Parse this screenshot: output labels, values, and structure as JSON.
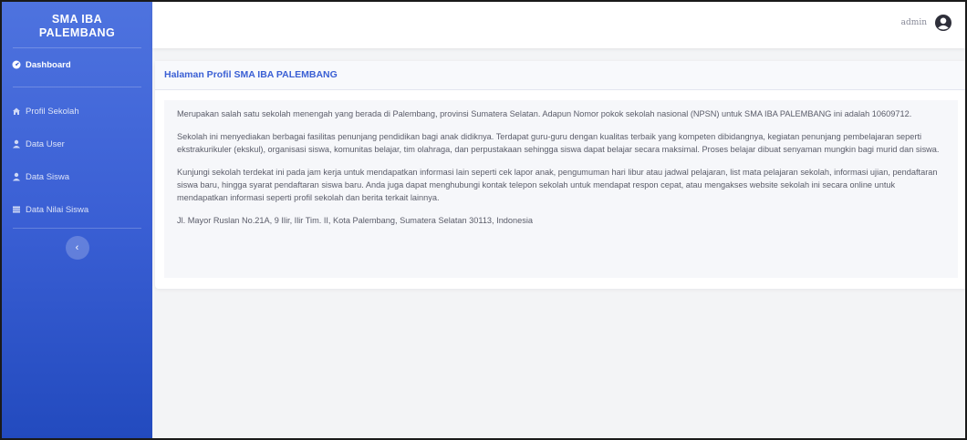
{
  "sidebar": {
    "brand_line1": "SMA IBA",
    "brand_line2": "PALEMBANG",
    "items": [
      {
        "label": "Dashboard",
        "icon": "dashboard-icon"
      },
      {
        "label": "Profil Sekolah",
        "icon": "home-icon"
      },
      {
        "label": "Data User",
        "icon": "user-icon"
      },
      {
        "label": "Data Siswa",
        "icon": "user-icon"
      },
      {
        "label": "Data Nilai Siswa",
        "icon": "table-icon"
      }
    ],
    "toggle_label": "‹"
  },
  "topbar": {
    "username": "admin"
  },
  "card": {
    "title": "Halaman Profil SMA IBA PALEMBANG",
    "paragraphs": [
      "Merupakan salah satu sekolah menengah yang berada di Palembang, provinsi Sumatera Selatan. Adapun Nomor pokok sekolah nasional (NPSN) untuk SMA IBA PALEMBANG ini adalah 10609712.",
      "Sekolah ini menyediakan berbagai fasilitas penunjang pendidikan bagi anak didiknya. Terdapat guru-guru dengan kualitas terbaik yang kompeten dibidangnya, kegiatan penunjang pembelajaran seperti ekstrakurikuler (ekskul), organisasi siswa, komunitas belajar, tim olahraga, dan perpustakaan sehingga siswa dapat belajar secara maksimal. Proses belajar dibuat senyaman mungkin bagi murid dan siswa.",
      "Kunjungi sekolah terdekat ini pada jam kerja untuk mendapatkan informasi lain seperti cek lapor anak, pengumuman hari libur atau jadwal pelajaran, list mata pelajaran sekolah, informasi ujian, pendaftaran siswa baru, hingga syarat pendaftaran siswa baru. Anda juga dapat menghubungi kontak telepon sekolah untuk mendapat respon cepat, atau mengakses website sekolah ini secara online untuk mendapatkan informasi seperti profil sekolah dan berita terkait lainnya.",
      "Jl. Mayor Ruslan No.21A, 9 Ilir, Ilir Tim. II, Kota Palembang, Sumatera Selatan 30113, Indonesia"
    ]
  },
  "colors": {
    "primary": "#4e73df",
    "sidebar_dark": "#224abe",
    "text": "#5a5c69"
  }
}
